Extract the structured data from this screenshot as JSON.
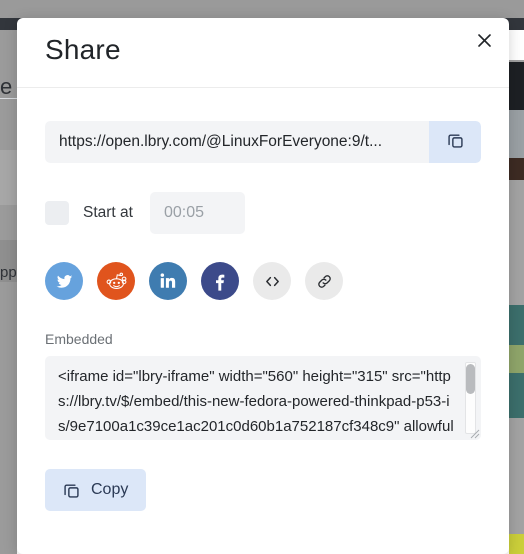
{
  "modal": {
    "title": "Share",
    "close_icon": "close-icon"
  },
  "share_url": {
    "value": "https://open.lbry.com/@LinuxForEveryone:9/t...",
    "copy_icon": "copy-icon"
  },
  "start_at": {
    "label": "Start at",
    "checked": false,
    "time_value": "00:05",
    "placeholder": "00:05"
  },
  "social": [
    {
      "name": "twitter",
      "label": "Twitter",
      "color": "#66a2dd"
    },
    {
      "name": "reddit",
      "label": "Reddit",
      "color": "#e0541d"
    },
    {
      "name": "linkedin",
      "label": "LinkedIn",
      "color": "#3f7cb0"
    },
    {
      "name": "facebook",
      "label": "Facebook",
      "color": "#3c4a8a"
    },
    {
      "name": "embed",
      "label": "Embed",
      "color": "#eaeaea"
    },
    {
      "name": "link",
      "label": "Copy link",
      "color": "#eaeaea"
    }
  ],
  "embedded": {
    "label": "Embedded",
    "code": "<iframe id=\"lbry-iframe\" width=\"560\" height=\"315\" src=\"https://lbry.tv/$/embed/this-new-fedora-powered-thinkpad-p53-is/9e7100a1c39ce1ac201c0d60b1a752187cf348c9\" allowfullscreen></iframe>"
  },
  "copy_button": {
    "label": "Copy",
    "icon": "copy-icon"
  },
  "colors": {
    "accent_bg": "#dce7f8",
    "accent_fg": "#2b3a55",
    "field_bg": "#f3f4f6",
    "modal_bg": "#ffffff"
  },
  "background_page": {
    "left_text_a": "e",
    "left_text_b": "pp"
  }
}
